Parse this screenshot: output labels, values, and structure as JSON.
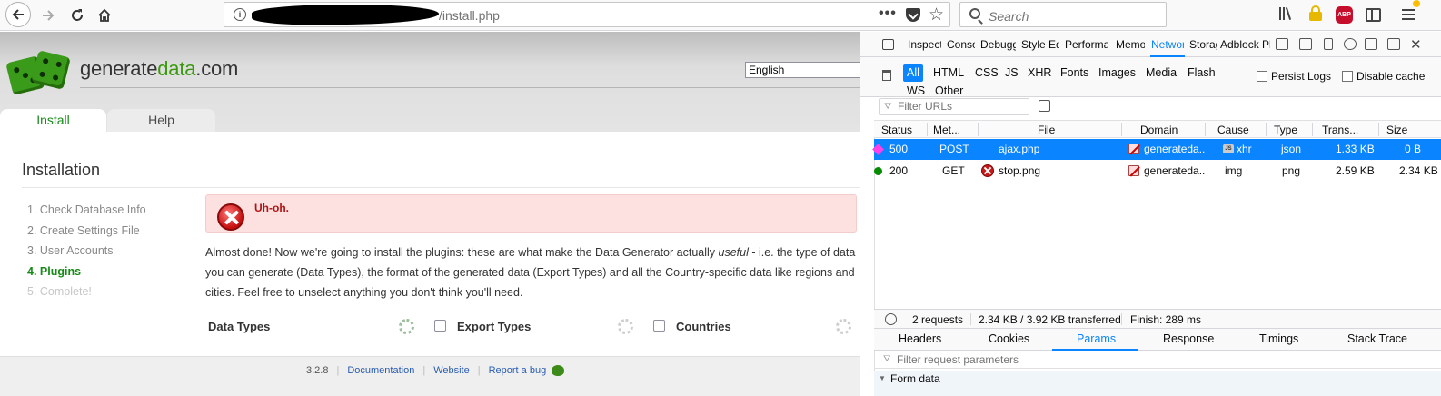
{
  "browser": {
    "url_suffix": "/install.php",
    "search_placeholder": "Search",
    "abp_label": "ABP"
  },
  "site": {
    "title_prefix": "generate",
    "title_accent": "data",
    "title_suffix": ".com",
    "language": "English",
    "tabs": [
      "Install",
      "Help"
    ],
    "heading": "Installation",
    "steps": [
      {
        "label": "1. Check Database Info",
        "state": "done"
      },
      {
        "label": "2. Create Settings File",
        "state": "done"
      },
      {
        "label": "3. User Accounts",
        "state": "done"
      },
      {
        "label": "4. Plugins",
        "state": "current"
      },
      {
        "label": "5. Complete!",
        "state": "later"
      }
    ],
    "alert_title": "Uh-oh.",
    "intro_part1": "Almost done! Now we're going to install the plugins: these are what make the Data Generator actually ",
    "intro_em": "useful",
    "intro_part2": " - i.e. the type of data you can generate (Data Types), the format of the generated data (Export Types) and all the Country-specific data like regions and cities. Feel free to unselect anything you don't think you'll need.",
    "plugins": [
      "Data Types",
      "Export Types",
      "Countries"
    ],
    "footer": {
      "version": "3.2.8",
      "links": [
        "Documentation",
        "Website",
        "Report a bug"
      ]
    }
  },
  "devtools": {
    "tabs": [
      "Inspector",
      "Console",
      "Debugger",
      "Style Editor",
      "Performance",
      "Memory",
      "Network",
      "Storage",
      "Adblock Plus"
    ],
    "active_tab": "Network",
    "filter_types": [
      "All",
      "HTML",
      "CSS",
      "JS",
      "XHR",
      "Fonts",
      "Images",
      "Media",
      "Flash",
      "WS",
      "Other"
    ],
    "active_filter": "All",
    "persist_logs": "Persist Logs",
    "disable_cache": "Disable cache",
    "filter_placeholder": "Filter URLs",
    "columns": [
      "Status",
      "Met...",
      "File",
      "Domain",
      "Cause",
      "Type",
      "Trans...",
      "Size"
    ],
    "rows": [
      {
        "status": "500",
        "method": "POST",
        "file": "ajax.php",
        "domain": "generateda...",
        "cause": "xhr",
        "cause_badge": "JS",
        "type": "json",
        "transferred": "1.33 KB",
        "size": "0 B",
        "selected": true
      },
      {
        "status": "200",
        "method": "GET",
        "file": "stop.png",
        "domain": "generateda...",
        "cause": "img",
        "type": "png",
        "transferred": "2.59 KB",
        "size": "2.34 KB",
        "selected": false
      }
    ],
    "summary": {
      "requests": "2 requests",
      "transferred": "2.34 KB / 3.92 KB transferred",
      "finish": "Finish: 289 ms"
    },
    "detail_tabs": [
      "Headers",
      "Cookies",
      "Params",
      "Response",
      "Timings",
      "Stack Trace"
    ],
    "active_detail_tab": "Params",
    "param_filter_placeholder": "Filter request parameters",
    "form_data_label": "Form data"
  }
}
